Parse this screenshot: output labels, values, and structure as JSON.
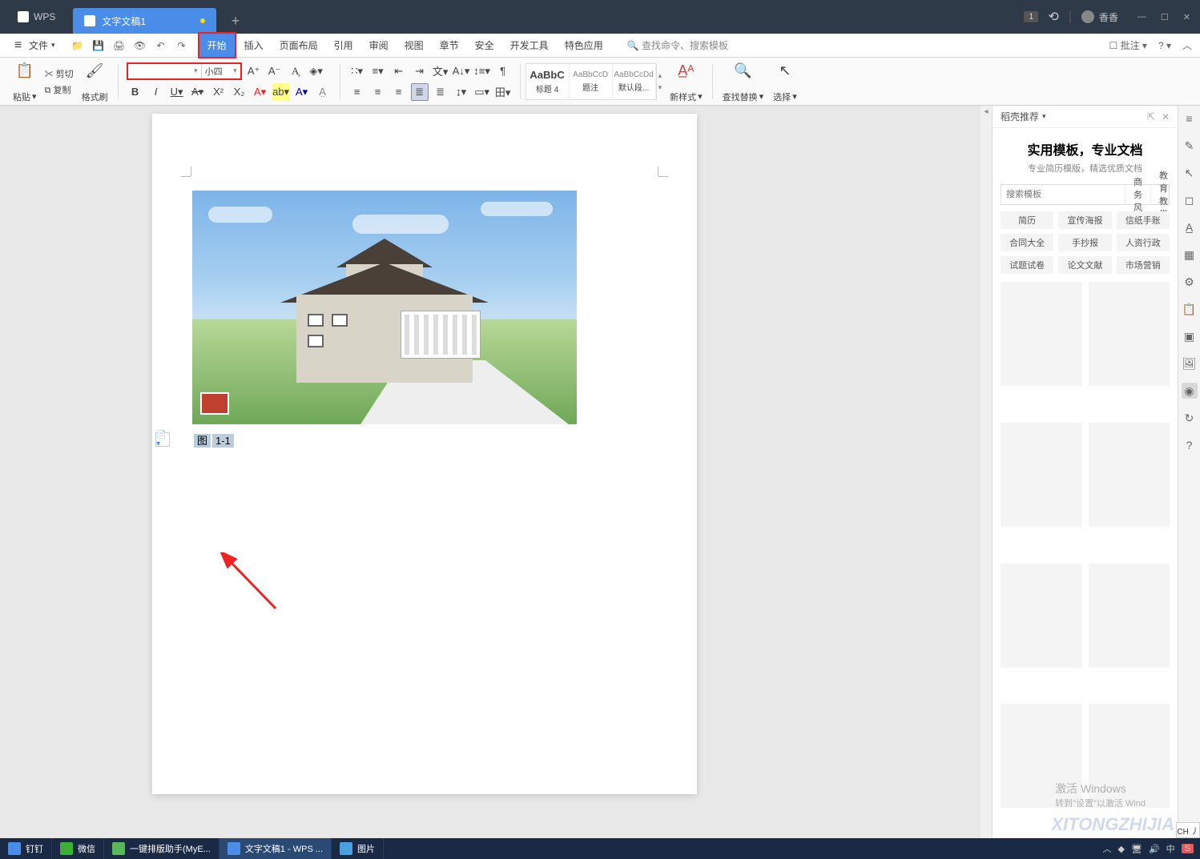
{
  "titlebar": {
    "app_name": "WPS",
    "doc_tab": "文字文稿1",
    "badge": "1",
    "user": "香香"
  },
  "menubar": {
    "file": "文件",
    "items": [
      "开始",
      "插入",
      "页面布局",
      "引用",
      "审阅",
      "视图",
      "章节",
      "安全",
      "开发工具",
      "特色应用"
    ],
    "search_tip": "查找命令、搜索模板",
    "annotate": "批注"
  },
  "ribbon": {
    "paste": "粘贴",
    "cut": "剪切",
    "copy": "复制",
    "format_painter": "格式刷",
    "font_name": "",
    "font_size": "小四",
    "styles": [
      {
        "preview": "AaBbC",
        "name": "标题 4"
      },
      {
        "preview": "AaBbCcD",
        "name": "题注"
      },
      {
        "preview": "AaBbCcDd",
        "name": "默认段..."
      }
    ],
    "new_style": "新样式",
    "find_replace": "查找替换",
    "select": "选择"
  },
  "document": {
    "caption_label": "图",
    "caption_num": "1-1"
  },
  "sidepanel": {
    "header": "稻壳推荐",
    "title": "实用模板，专业文档",
    "subtitle": "专业简历模版，精选优质文档",
    "search_placeholder": "搜索模板",
    "tabs": [
      "商务风",
      "教育教学"
    ],
    "tags": [
      "简历",
      "宣传海报",
      "信纸手账",
      "合同大全",
      "手抄报",
      "人资行政",
      "试题试卷",
      "论文文献",
      "市场营销"
    ]
  },
  "activate": {
    "line1": "激活 Windows",
    "line2": "转到\"设置\"以激活 Wind"
  },
  "taskbar": {
    "items": [
      {
        "label": "钉钉",
        "color": "#4a8de8"
      },
      {
        "label": "微信",
        "color": "#3cb034"
      },
      {
        "label": "一键排版助手(MyE...",
        "color": "#58b858"
      },
      {
        "label": "文字文稿1 - WPS ...",
        "color": "#4a8de8",
        "active": true
      },
      {
        "label": "图片",
        "color": "#48a0e0"
      }
    ],
    "ime": "CH 丿",
    "tray_ime": "中"
  },
  "watermark": "XITONGZHIJIA"
}
